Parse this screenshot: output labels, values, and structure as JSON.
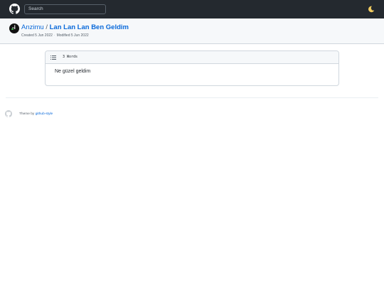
{
  "header": {
    "logo_icon": "github-octocat-icon",
    "search_placeholder": "Search",
    "theme_icon": "moon-icon"
  },
  "gist": {
    "owner": "Anzimu",
    "separator": "/",
    "title": "Lan Lan Lan Ben Geldim",
    "created": "Created 5 Jun 2022",
    "modified": "Modified 5 Jun 2022"
  },
  "file": {
    "word_count": "3 Words",
    "content": "Ne güzel geldim"
  },
  "footer": {
    "theme_prefix": "Theme by",
    "theme_link": "github-style"
  },
  "colors": {
    "topbar": "#24292f",
    "link": "#0969da",
    "header_bg": "#f6f8fa",
    "border": "#d0d7de"
  }
}
